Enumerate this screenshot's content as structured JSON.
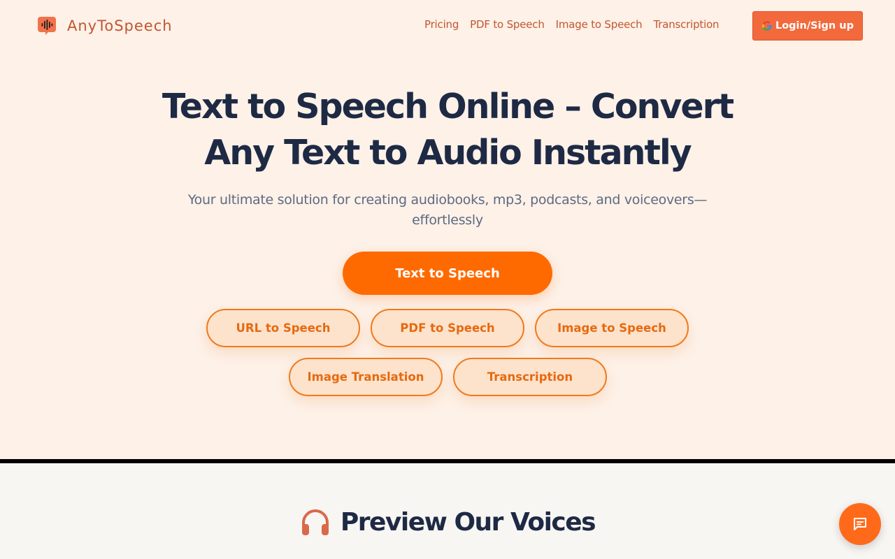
{
  "header": {
    "brand_name": "AnyToSpeech",
    "nav": [
      {
        "label": "Pricing"
      },
      {
        "label": "PDF to Speech"
      },
      {
        "label": "Image to Speech"
      },
      {
        "label": "Transcription"
      }
    ],
    "login_label": "Login/Sign up"
  },
  "hero": {
    "title_line1": "Text to Speech Online – Convert",
    "title_line2": "Any Text to Audio Instantly",
    "subtitle": "Your ultimate solution for creating audiobooks, mp3, podcasts, and voiceovers—effortlessly",
    "primary_button": "Text to Speech",
    "tools": [
      {
        "label": "URL to Speech"
      },
      {
        "label": "PDF to Speech"
      },
      {
        "label": "Image to Speech"
      },
      {
        "label": "Image Translation"
      },
      {
        "label": "Transcription"
      }
    ]
  },
  "voices": {
    "title": "Preview Our Voices"
  },
  "icons": {
    "brand": "sound-wave-bubble-icon",
    "login": "google-icon",
    "voices": "headphones-icon",
    "chat": "chat-icon"
  },
  "colors": {
    "accent": "#ff6a00",
    "brand": "#c2562f",
    "login_bg": "#f26a3c",
    "pill_bg": "#fde2cc",
    "pill_border": "#f07a1c",
    "hero_bg": "#fdf1e8",
    "heading": "#1e2a44"
  }
}
